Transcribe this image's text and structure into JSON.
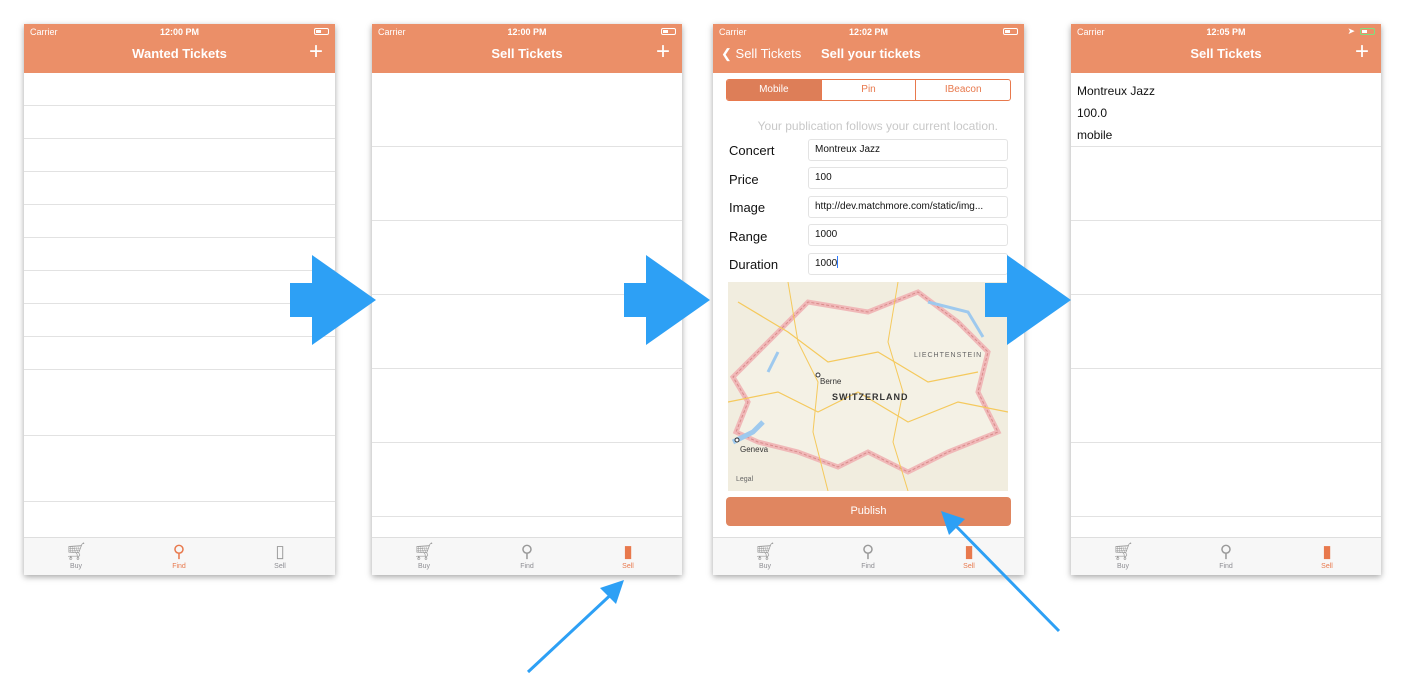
{
  "colors": {
    "accent": "#eb8f68",
    "arrow": "#2da0f5"
  },
  "screen1": {
    "status": {
      "carrier": "Carrier",
      "time": "12:00 PM"
    },
    "title": "Wanted Tickets",
    "plus": "+",
    "tabs": [
      {
        "label": "Buy",
        "icon": "cart-icon"
      },
      {
        "label": "Find",
        "icon": "search-icon"
      },
      {
        "label": "Sell",
        "icon": "ticket-icon"
      }
    ]
  },
  "screen2": {
    "status": {
      "carrier": "Carrier",
      "time": "12:00 PM"
    },
    "title": "Sell Tickets",
    "plus": "+",
    "tabs": [
      {
        "label": "Buy",
        "icon": "cart-icon"
      },
      {
        "label": "Find",
        "icon": "search-icon"
      },
      {
        "label": "Sell",
        "icon": "ticket-icon"
      }
    ]
  },
  "screen3": {
    "status": {
      "carrier": "Carrier",
      "time": "12:02 PM"
    },
    "back": "Sell Tickets",
    "title": "Sell your tickets",
    "segments": [
      "Mobile",
      "Pin",
      "IBeacon"
    ],
    "hint": "Your publication follows your current location.",
    "fields": [
      {
        "label": "Concert",
        "value": "Montreux Jazz"
      },
      {
        "label": "Price",
        "value": "100"
      },
      {
        "label": "Image",
        "value": "http://dev.matchmore.com/static/img..."
      },
      {
        "label": "Range",
        "value": "1000"
      },
      {
        "label": "Duration",
        "value": "1000"
      }
    ],
    "map": {
      "country": "SWITZERLAND",
      "city1": "Berne",
      "city2": "Geneva",
      "neighbor": "LIECHTENSTEIN",
      "legal": "Legal"
    },
    "publish": "Publish",
    "tabs": [
      {
        "label": "Buy",
        "icon": "cart-icon"
      },
      {
        "label": "Find",
        "icon": "search-icon"
      },
      {
        "label": "Sell",
        "icon": "ticket-icon"
      }
    ]
  },
  "screen4": {
    "status": {
      "carrier": "Carrier",
      "time": "12:05 PM"
    },
    "title": "Sell Tickets",
    "plus": "+",
    "listing": {
      "concert": "Montreux Jazz",
      "price": "100.0",
      "mode": "mobile"
    },
    "tabs": [
      {
        "label": "Buy",
        "icon": "cart-icon"
      },
      {
        "label": "Find",
        "icon": "search-icon"
      },
      {
        "label": "Sell",
        "icon": "ticket-icon"
      }
    ]
  }
}
